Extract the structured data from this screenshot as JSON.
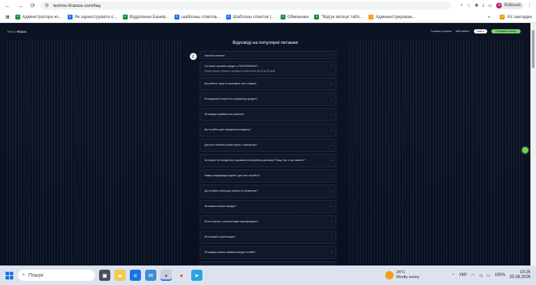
{
  "browser": {
    "url": "techno-finance.com/faq",
    "profile_label": "Робочий",
    "profile_initial": "A",
    "bookmarks": [
      {
        "label": "Адміністратори ко...",
        "icon": "sheets-icon"
      },
      {
        "label": "Як зареєструвати о...",
        "icon": "doc-icon"
      },
      {
        "label": "Відділення Банків...",
        "icon": "sheets-icon"
      },
      {
        "label": "шаблоны ответов...",
        "icon": "doc-icon"
      },
      {
        "label": "Шаблоны ответов (...",
        "icon": "doc-icon"
      },
      {
        "label": "Обмінники",
        "icon": "sheets-icon"
      },
      {
        "label": "\"Відгук місяця табл...",
        "icon": "sheets-icon"
      },
      {
        "label": "Администрирован...",
        "icon": "folder-icon"
      }
    ],
    "all_bookmarks_label": "Усі закладки"
  },
  "site": {
    "logo_brand": "Техно",
    "logo_rest": "Фінанс",
    "header_links": [
      "Головна сторінка",
      "Мій кабінет"
    ],
    "login_button": "Увійти",
    "cta_button": "Отримати позику",
    "page_title": "Відповіді на популярні питання"
  },
  "faq": [
    {
      "q": "Загальні питання"
    },
    {
      "q": "Хто може отримати кредит у ТЕХНОФІНАНС?",
      "a": "Кредит можуть отримати громадяни України віком від 18 до 65 років."
    },
    {
      "q": "Що робити, якщо не приходить смс з кодом?"
    },
    {
      "q": "Як подовжити кошти на отриманому кредиті?"
    },
    {
      "q": "Як швидко приймається рішення?"
    },
    {
      "q": "Що потрібно для оформлення кредиту?"
    },
    {
      "q": "Для чого потрібно робити фото з паспортом?"
    },
    {
      "q": "Чи можу я не погодитися з умовами електронного договору? Якщо так, то де змінити?"
    },
    {
      "q": "Навіщо верифікація картки і для чого потрібно?"
    },
    {
      "q": "Що потрібно знати для оплати та погашення?"
    },
    {
      "q": "Як можна погасити кредит?"
    },
    {
      "q": "Як не платити, а пролонгацію переоформити?"
    },
    {
      "q": "Як отримати пролонгацію?"
    },
    {
      "q": "Як швидко можна отримати кредит онлайн?"
    }
  ],
  "taskbar": {
    "search_placeholder": "Пошук",
    "weather_temp": "26°C",
    "weather_desc": "Mostly sunny",
    "lang": "УКР",
    "battery": "100%",
    "time": "19:25",
    "date": "25.08.2026"
  }
}
